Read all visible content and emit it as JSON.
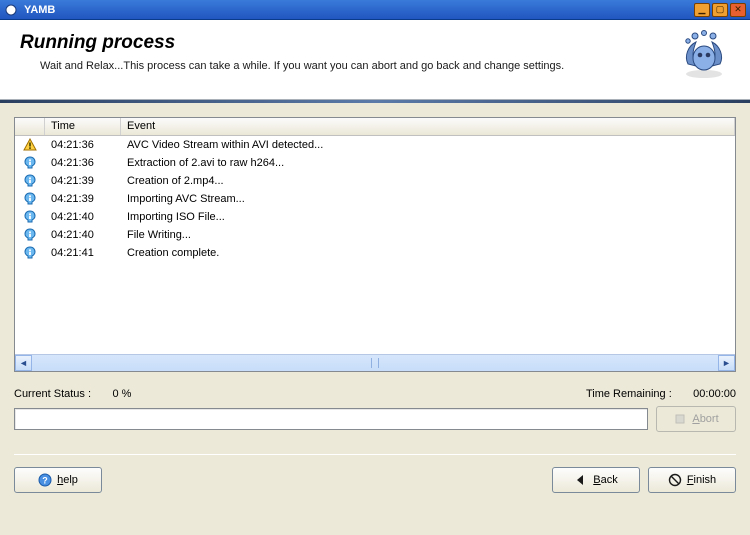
{
  "window": {
    "title": "YAMB"
  },
  "header": {
    "heading": "Running process",
    "subtitle": "Wait and Relax...This process can take a while. If you want you can abort and go back and change settings."
  },
  "log": {
    "columns": {
      "time": "Time",
      "event": "Event"
    },
    "rows": [
      {
        "icon": "warn",
        "time": "04:21:36",
        "event": "AVC Video Stream within AVI detected..."
      },
      {
        "icon": "info",
        "time": "04:21:36",
        "event": "Extraction of 2.avi to raw h264..."
      },
      {
        "icon": "info",
        "time": "04:21:39",
        "event": "Creation of 2.mp4..."
      },
      {
        "icon": "info",
        "time": "04:21:39",
        "event": "Importing AVC Stream..."
      },
      {
        "icon": "info",
        "time": "04:21:40",
        "event": "Importing ISO File..."
      },
      {
        "icon": "info",
        "time": "04:21:40",
        "event": "File Writing..."
      },
      {
        "icon": "info",
        "time": "04:21:41",
        "event": "Creation complete."
      }
    ]
  },
  "status": {
    "current_label": "Current Status :",
    "current_value": "0 %",
    "remaining_label": "Time Remaining :",
    "remaining_value": "00:00:00"
  },
  "buttons": {
    "abort": "Abort",
    "help": "help",
    "back": "Back",
    "finish": "Finish"
  }
}
